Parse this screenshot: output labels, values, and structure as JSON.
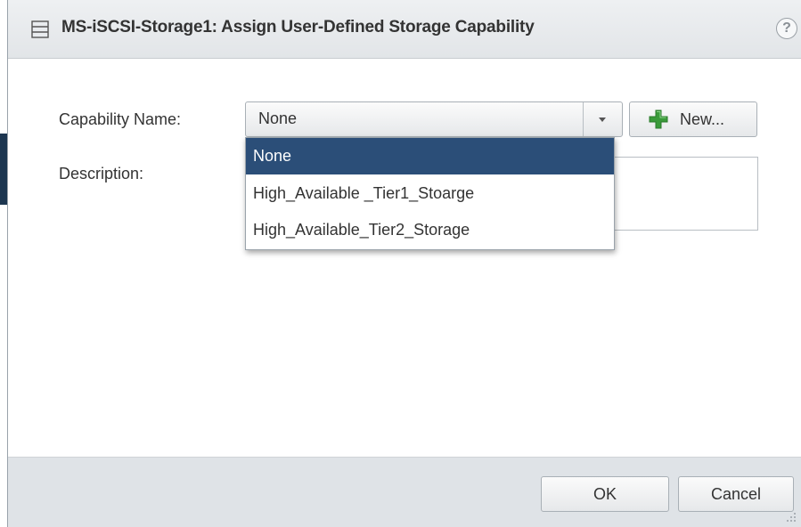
{
  "dialog": {
    "title": "MS-iSCSI-Storage1: Assign User-Defined Storage Capability",
    "help_glyph": "?"
  },
  "form": {
    "capability_label": "Capability Name:",
    "description_label": "Description:",
    "capability_value": "None",
    "description_value": "",
    "new_button_label": "New..."
  },
  "dropdown": {
    "options": [
      {
        "label": "None",
        "selected": true
      },
      {
        "label": "High_Available _Tier1_Stoarge",
        "selected": false
      },
      {
        "label": "High_Available_Tier2_Storage",
        "selected": false
      }
    ]
  },
  "footer": {
    "ok_label": "OK",
    "cancel_label": "Cancel"
  },
  "colors": {
    "selection": "#2b4e78",
    "plus_icon": "#3a9a3a",
    "footer_bg": "#dfe3e7"
  },
  "icons": {
    "title": "storage-icon",
    "help": "help-icon",
    "new": "plus-icon",
    "dropdown": "chevron-down-icon"
  }
}
